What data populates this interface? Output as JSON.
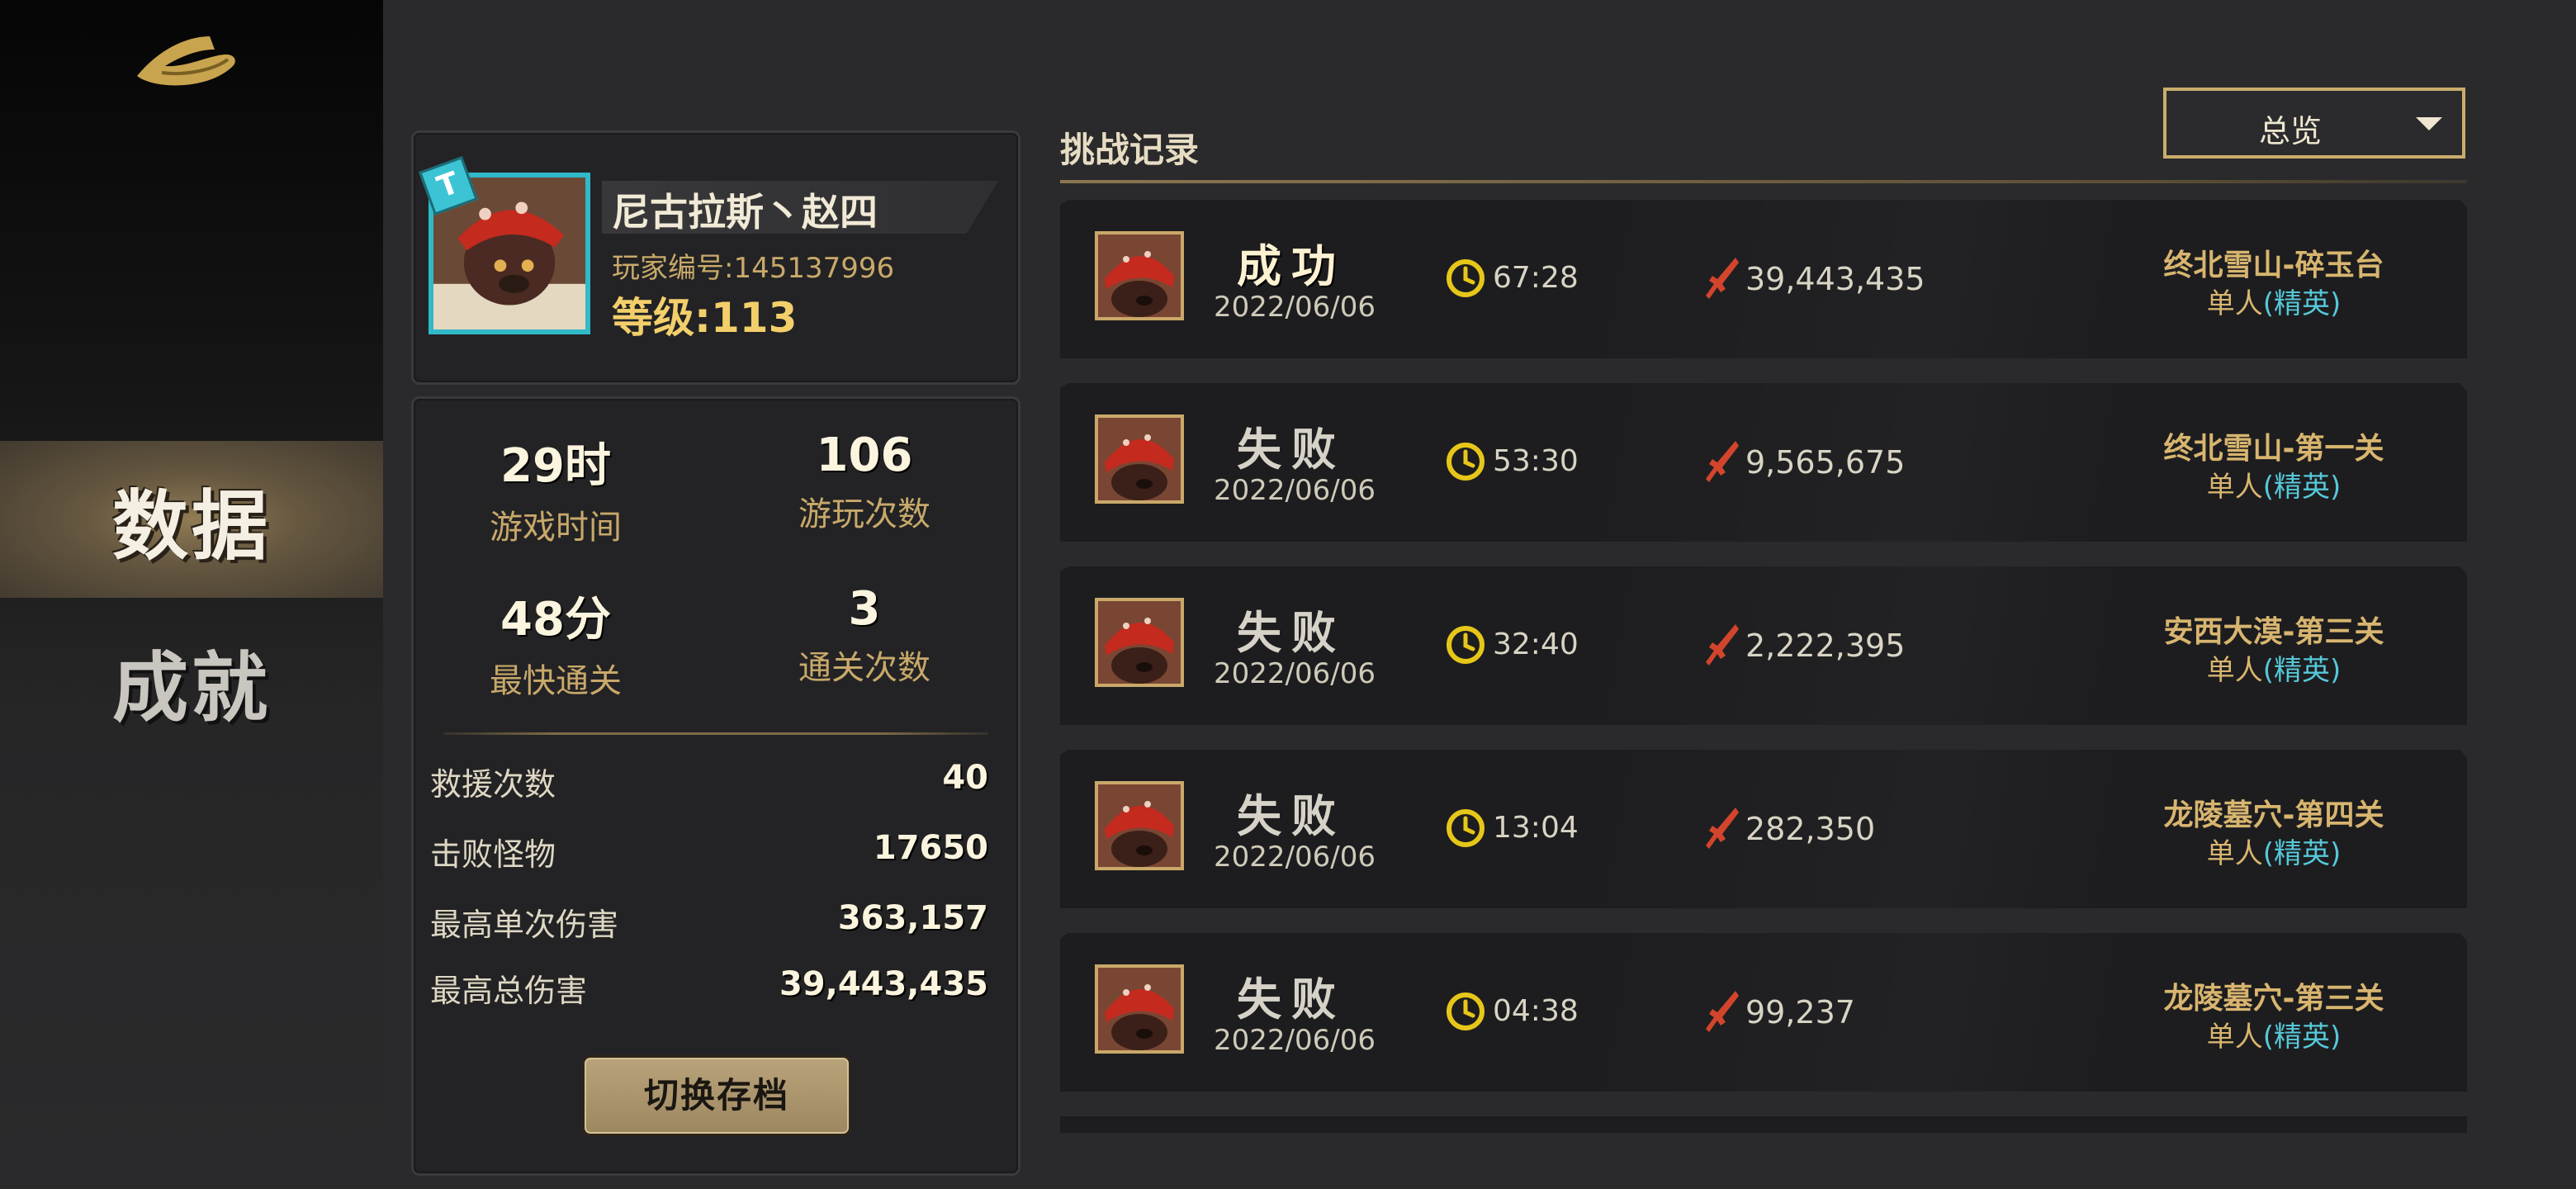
{
  "nav": {
    "items": [
      {
        "label": "数据",
        "active": true
      },
      {
        "label": "成就",
        "active": false
      }
    ]
  },
  "profile": {
    "team_badge": "T",
    "name": "尼古拉斯丶赵四",
    "id_text": "玩家编号:145137996",
    "level_text": "等级:113"
  },
  "summary": [
    {
      "value": "29时",
      "label": "游戏时间"
    },
    {
      "value": "106",
      "label": "游玩次数"
    },
    {
      "value": "48分",
      "label": "最快通关"
    },
    {
      "value": "3",
      "label": "通关次数"
    }
  ],
  "details": [
    {
      "label": "救援次数",
      "value": "40"
    },
    {
      "label": "击败怪物",
      "value": "17650"
    },
    {
      "label": "最高单次伤害",
      "value": "363,157"
    },
    {
      "label": "最高总伤害",
      "value": "39,443,435"
    }
  ],
  "switch_button": "切换存档",
  "records_title": "挑战记录",
  "filter": {
    "selected": "总览"
  },
  "records": [
    {
      "result": "成功",
      "win": true,
      "date": "2022/06/06",
      "time": "67:28",
      "damage": "39,443,435",
      "stage": "终北雪山-碎玉台",
      "mode": "单人",
      "difficulty": "(精英)"
    },
    {
      "result": "失败",
      "win": false,
      "date": "2022/06/06",
      "time": "53:30",
      "damage": "9,565,675",
      "stage": "终北雪山-第一关",
      "mode": "单人",
      "difficulty": "(精英)"
    },
    {
      "result": "失败",
      "win": false,
      "date": "2022/06/06",
      "time": "32:40",
      "damage": "2,222,395",
      "stage": "安西大漠-第三关",
      "mode": "单人",
      "difficulty": "(精英)"
    },
    {
      "result": "失败",
      "win": false,
      "date": "2022/06/06",
      "time": "13:04",
      "damage": "282,350",
      "stage": "龙陵墓穴-第四关",
      "mode": "单人",
      "difficulty": "(精英)"
    },
    {
      "result": "失败",
      "win": false,
      "date": "2022/06/06",
      "time": "04:38",
      "damage": "99,237",
      "stage": "龙陵墓穴-第三关",
      "mode": "单人",
      "difficulty": "(精英)"
    }
  ],
  "colors": {
    "accent_gold": "#c9ad6c",
    "difficulty_cyan": "#56c8d8",
    "clock_yellow": "#e6c619",
    "sword_red": "#d2432a"
  }
}
